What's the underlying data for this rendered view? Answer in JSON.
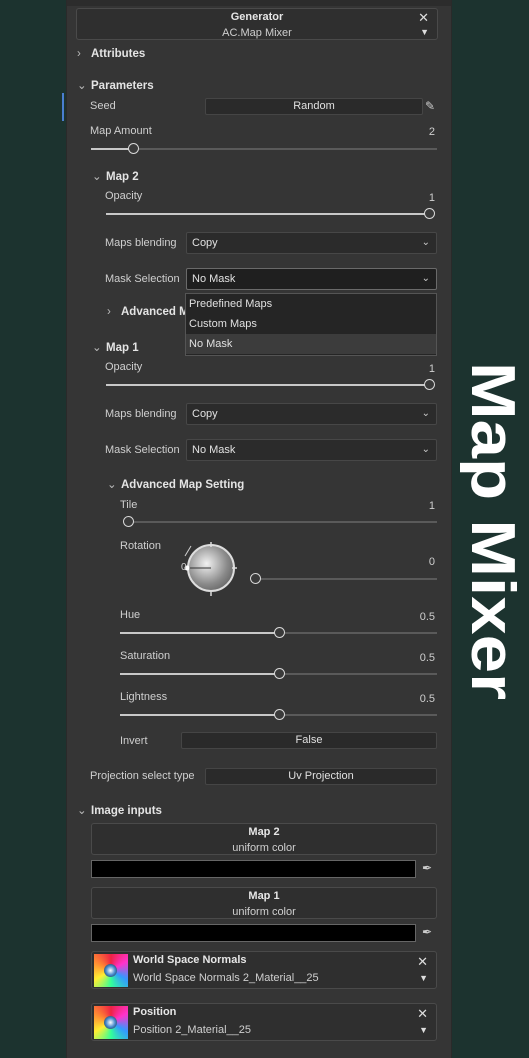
{
  "generator": {
    "title": "Generator",
    "value": "AC.Map Mixer"
  },
  "sections": {
    "attributes": "Attributes",
    "parameters": "Parameters",
    "image_inputs": "Image inputs"
  },
  "seed": {
    "label": "Seed",
    "button": "Random"
  },
  "map_amount": {
    "label": "Map Amount",
    "value": "2",
    "level": 0.12
  },
  "map2": {
    "title": "Map 2",
    "opacity": {
      "label": "Opacity",
      "value": "1",
      "level": 1.0
    },
    "blending": {
      "label": "Maps blending",
      "value": "Copy"
    },
    "mask": {
      "label": "Mask Selection",
      "value": "No Mask"
    },
    "advanced": "Advanced Map Setting",
    "advanced_visible": "Advanced M"
  },
  "dropdown": {
    "options": [
      "Predefined Maps",
      "Custom Maps",
      "No Mask"
    ],
    "selected": "No Mask"
  },
  "map1": {
    "title": "Map 1",
    "opacity": {
      "label": "Opacity",
      "value": "1",
      "level": 1.0
    },
    "blending": {
      "label": "Maps blending",
      "value": "Copy"
    },
    "mask": {
      "label": "Mask Selection",
      "value": "No Mask"
    },
    "advanced": "Advanced Map Setting",
    "tile": {
      "label": "Tile",
      "value": "1",
      "level": 0.0
    },
    "rotation": {
      "label": "Rotation",
      "value": "0",
      "dial_value": "0",
      "level": 0.0
    },
    "hue": {
      "label": "Hue",
      "value": "0.5",
      "level": 0.5
    },
    "saturation": {
      "label": "Saturation",
      "value": "0.5",
      "level": 0.5
    },
    "lightness": {
      "label": "Lightness",
      "value": "0.5",
      "level": 0.5
    },
    "invert": {
      "label": "Invert",
      "value": "False"
    }
  },
  "projection": {
    "label": "Projection select type",
    "value": "Uv Projection"
  },
  "inputs": {
    "map2": {
      "title": "Map 2",
      "value": "uniform color",
      "color": "#000000"
    },
    "map1": {
      "title": "Map 1",
      "value": "uniform color",
      "color": "#000000"
    },
    "wsn": {
      "title": "World Space Normals",
      "value": "World Space Normals 2_Material__25"
    },
    "position": {
      "title": "Position",
      "value": "Position 2_Material__25"
    }
  },
  "side_title": "Map Mixer",
  "colors": {
    "background": "#1c332f",
    "panel": "#353535",
    "side_text": "#ffffff"
  }
}
